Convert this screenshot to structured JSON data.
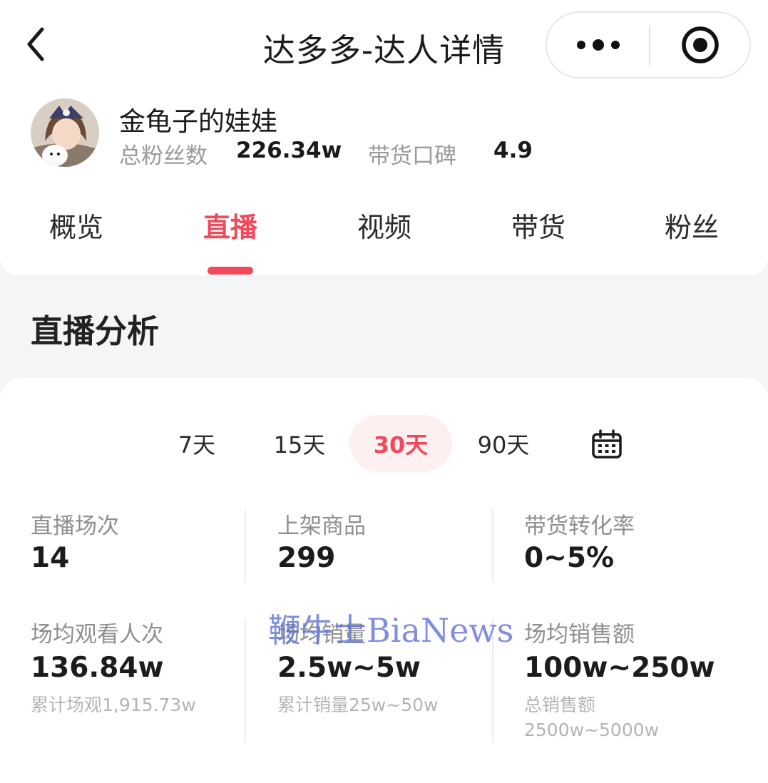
{
  "navbar": {
    "title": "达多多-达人详情",
    "back_icon": "chevron-left-icon",
    "more_icon": "more-dots-icon",
    "target_icon": "record-target-icon"
  },
  "profile": {
    "name": "金龟子的娃娃",
    "followers_label": "总粉丝数",
    "followers_value": "226.34w",
    "reputation_label": "带货口碑",
    "reputation_value": "4.9"
  },
  "tabs": [
    {
      "label": "概览",
      "active": false
    },
    {
      "label": "直播",
      "active": true
    },
    {
      "label": "视频",
      "active": false
    },
    {
      "label": "带货",
      "active": false
    },
    {
      "label": "粉丝",
      "active": false
    }
  ],
  "section": {
    "title": "直播分析"
  },
  "ranges": [
    {
      "label": "7天",
      "active": false
    },
    {
      "label": "15天",
      "active": false
    },
    {
      "label": "30天",
      "active": true
    },
    {
      "label": "90天",
      "active": false
    }
  ],
  "calendar_icon": "calendar-icon",
  "metrics": [
    {
      "label": "直播场次",
      "value": "14"
    },
    {
      "label": "上架商品",
      "value": "299"
    },
    {
      "label": "带货转化率",
      "value": "0~5%"
    },
    {
      "label": "场均观看人次",
      "value": "136.84w",
      "sub": "累计场观1,915.73w"
    },
    {
      "label": "场均销量",
      "value": "2.5w~5w",
      "sub": "累计销量25w~50w"
    },
    {
      "label": "场均销售额",
      "value": "100w~250w",
      "sub": "总销售额",
      "sub2": "2500w~5000w"
    }
  ],
  "watermark": "鞭牛士BiaNews",
  "colors": {
    "accent": "#ee4a5c",
    "accent_bg": "#fdf0f1",
    "page_bg": "#f4f5f6"
  }
}
